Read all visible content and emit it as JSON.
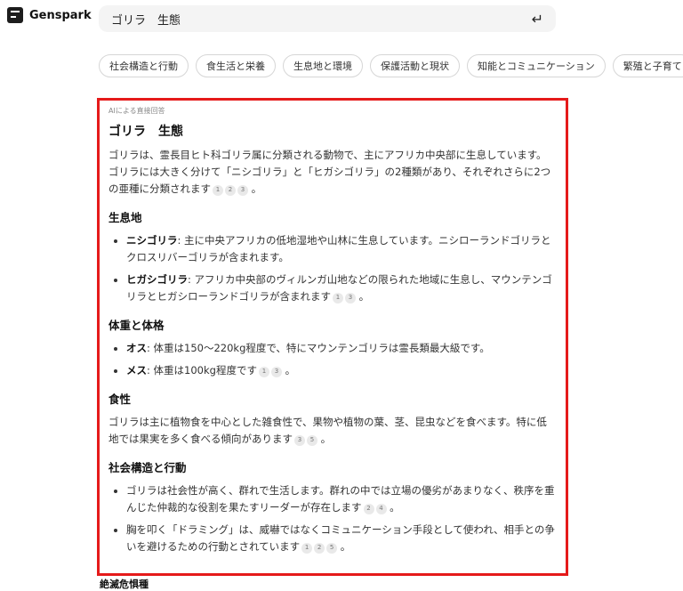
{
  "app": {
    "name": "Genspark"
  },
  "search": {
    "value": "ゴリラ　生態"
  },
  "chips": [
    "社会構造と行動",
    "食生活と栄養",
    "生息地と環境",
    "保護活動と現状",
    "知能とコミュニケーション",
    "繁殖と子育て"
  ],
  "answer": {
    "label": "AIによる直接回答",
    "title": "ゴリラ　生態",
    "intro": "ゴリラは、霊長目ヒト科ゴリラ属に分類される動物で、主にアフリカ中央部に生息しています。ゴリラには大きく分けて「ニシゴリラ」と「ヒガシゴリラ」の2種類があり、それぞれさらに2つの亜種に分類されます",
    "intro_cites": [
      "1",
      "2",
      "3"
    ],
    "sections": {
      "habitat": {
        "heading": "生息地",
        "items": [
          {
            "term": "ニシゴリラ",
            "text": ": 主に中央アフリカの低地湿地や山林に生息しています。ニシローランドゴリラとクロスリバーゴリラが含まれます。"
          },
          {
            "term": "ヒガシゴリラ",
            "text": ": アフリカ中央部のヴィルンガ山地などの限られた地域に生息し、マウンテンゴリラとヒガシローランドゴリラが含まれます",
            "cites": [
              "1",
              "3"
            ]
          }
        ]
      },
      "body": {
        "heading": "体重と体格",
        "items": [
          {
            "term": "オス",
            "text": ": 体重は150〜220kg程度で、特にマウンテンゴリラは霊長類最大級です。"
          },
          {
            "term": "メス",
            "text": ": 体重は100kg程度です",
            "cites": [
              "1",
              "3"
            ]
          }
        ]
      },
      "diet": {
        "heading": "食性",
        "text": "ゴリラは主に植物食を中心とした雑食性で、果物や植物の葉、茎、昆虫などを食べます。特に低地では果実を多く食べる傾向があります",
        "cites": [
          "3",
          "5"
        ]
      },
      "social": {
        "heading": "社会構造と行動",
        "items": [
          {
            "text": "ゴリラは社会性が高く、群れで生活します。群れの中では立場の優劣があまりなく、秩序を重んじた仲裁的な役割を果たすリーダーが存在します",
            "cites": [
              "2",
              "4"
            ]
          },
          {
            "text": "胸を叩く「ドラミング」は、威嚇ではなくコミュニケーション手段として使われ、相手との争いを避けるための行動とされています",
            "cites": [
              "1",
              "2",
              "5"
            ]
          }
        ]
      }
    }
  },
  "next_heading_peek": "絶滅危惧種"
}
